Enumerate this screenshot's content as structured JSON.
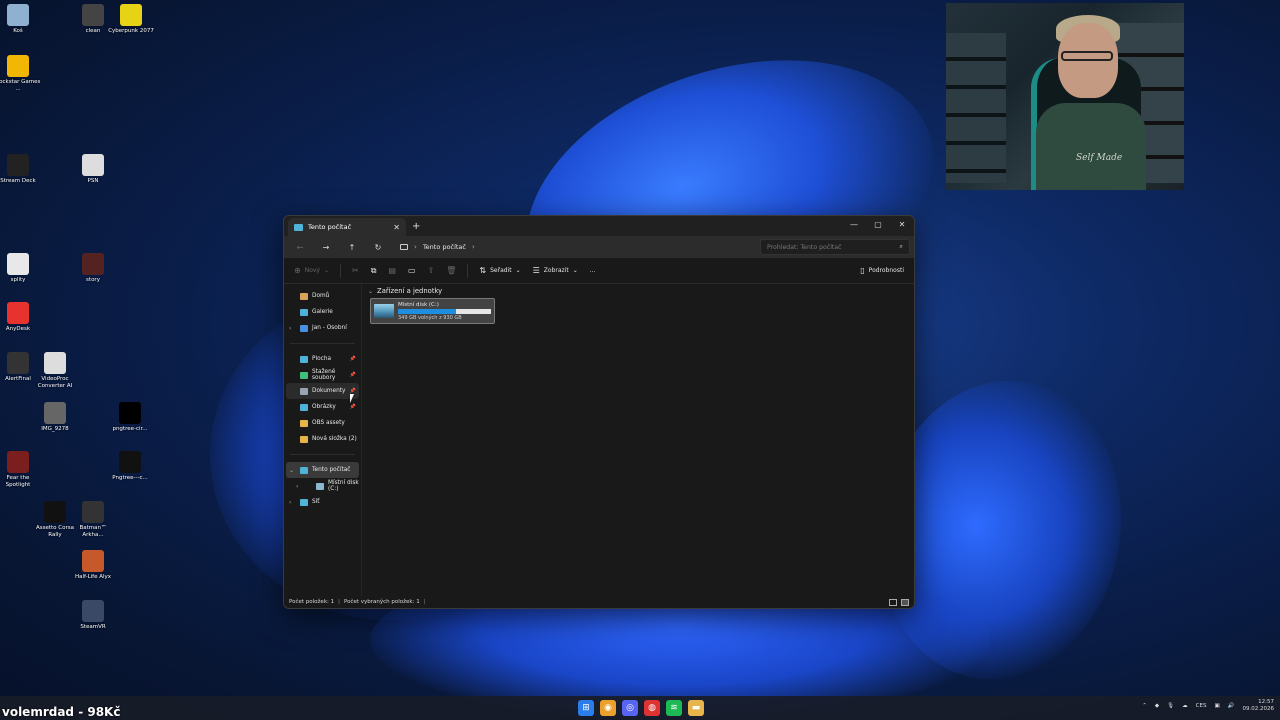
{
  "desktop_icons": [
    {
      "label": "Koš",
      "icon": "recycle-bin-icon",
      "color": "#8fb0d0"
    },
    {
      "label": "clean",
      "icon": "app-icon",
      "color": "#444444"
    },
    {
      "label": "Cyberpunk 2077",
      "icon": "game-icon",
      "color": "#e7d315"
    },
    {
      "label": "Rockstar Games ...",
      "icon": "rockstar-icon",
      "color": "#f2b705"
    },
    {
      "label": "Stream Deck",
      "icon": "stream-deck-icon",
      "color": "#222222"
    },
    {
      "label": "PSN",
      "icon": "file-icon",
      "color": "#dddddd"
    },
    {
      "label": "splity",
      "icon": "splity-icon",
      "color": "#e8e8e8"
    },
    {
      "label": "story",
      "icon": "image-icon",
      "color": "#552222"
    },
    {
      "label": "AnyDesk",
      "icon": "anydesk-icon",
      "color": "#e8322e"
    },
    {
      "label": "AlertFinal",
      "icon": "image-icon",
      "color": "#333333"
    },
    {
      "label": "VideoProc Converter AI",
      "icon": "videoproc-icon",
      "color": "#dddddd"
    },
    {
      "label": "IMG_9278",
      "icon": "image-icon",
      "color": "#666666"
    },
    {
      "label": "pngtree-cir...",
      "icon": "image-icon",
      "color": "#000000"
    },
    {
      "label": "Fear the Spotlight",
      "icon": "game-icon",
      "color": "#7a1e1e"
    },
    {
      "label": "Pngtree---c...",
      "icon": "image-icon",
      "color": "#111111"
    },
    {
      "label": "Assetto Corsa Rally",
      "icon": "game-icon",
      "color": "#111111"
    },
    {
      "label": "Batman™ Arkha...",
      "icon": "game-icon",
      "color": "#333333"
    },
    {
      "label": "Half-Life Alyx",
      "icon": "halflife-icon",
      "color": "#c6582a"
    },
    {
      "label": "SteamVR",
      "icon": "steamvr-icon",
      "color": "#3a4a66"
    }
  ],
  "window": {
    "tab_title": "Tento počítač",
    "new_tab": "+",
    "address": "Tento počítač",
    "search_placeholder": "Prohledat: Tento počítač"
  },
  "commands": {
    "new": "Nový",
    "sort": "Seřadit",
    "view": "Zobrazit",
    "more": "...",
    "details": "Podrobnosti"
  },
  "sidebar": {
    "quick": [
      {
        "label": "Domů",
        "name": "sidebar-item-home",
        "color": "#d8a25a"
      },
      {
        "label": "Galerie",
        "name": "sidebar-item-gallery",
        "color": "#4fb3d9"
      },
      {
        "label": "Jan - Osobní",
        "name": "sidebar-item-onedrive",
        "color": "#4a90e2"
      }
    ],
    "pinned": [
      {
        "label": "Plocha",
        "name": "sidebar-item-desktop",
        "color": "#4fb3d9"
      },
      {
        "label": "Stažené soubory",
        "name": "sidebar-item-downloads",
        "color": "#3fc07a"
      },
      {
        "label": "Dokumenty",
        "name": "sidebar-item-documents",
        "color": "#9aa3b0"
      },
      {
        "label": "Obrázky",
        "name": "sidebar-item-pictures",
        "color": "#4fb3d9"
      },
      {
        "label": "OBS assety",
        "name": "sidebar-item-obs",
        "color": "#e8b54a"
      },
      {
        "label": "Nová složka (2)",
        "name": "sidebar-item-new-folder",
        "color": "#e8b54a"
      }
    ],
    "this_pc": "Tento počítač",
    "local_disk": "Místní disk (C:)",
    "network": "Síť"
  },
  "content": {
    "group_title": "Zařízení a jednotky",
    "drive_name": "Místní disk (C:)",
    "drive_free": "349 GB volných z 930 GB",
    "drive_used_fraction": 0.62
  },
  "status": {
    "items_count": "Počet položek: 1",
    "selected_count": "Počet vybraných položek: 1",
    "sep": "|"
  },
  "overlay_text": "volemrdad - 98Kč",
  "tray": {
    "lang": "CES",
    "time": "12:57",
    "date": "09.02.2026"
  }
}
